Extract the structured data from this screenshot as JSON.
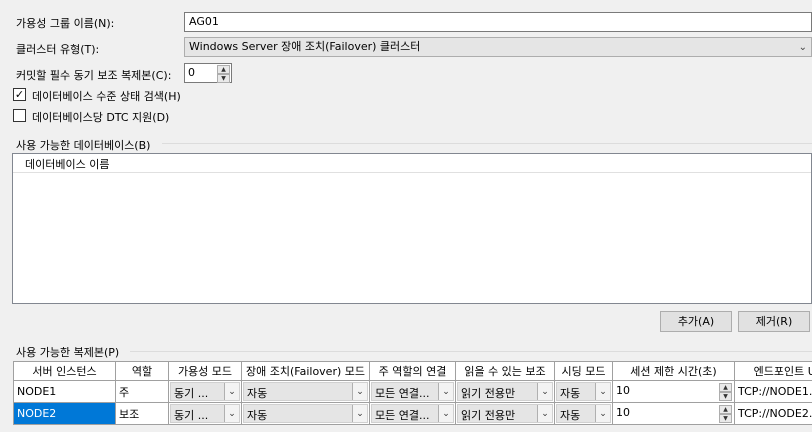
{
  "form": {
    "ag_name_label": "가용성 그룹 이름(N):",
    "ag_name_value": "AG01",
    "cluster_type_label": "클러스터 유형(T):",
    "cluster_type_value": "Windows Server 장애 조치(Failover) 클러스터",
    "required_sync_label": "커밋할 필수 동기 보조 복제본(C):",
    "required_sync_value": "0",
    "db_health_label": "데이터베이스 수준 상태 검색(H)",
    "db_health_checked": true,
    "dtc_label": "데이터베이스당 DTC 지원(D)",
    "dtc_checked": false
  },
  "databases": {
    "group_label": "사용 가능한 데이터베이스(B)",
    "column_header": "데이터베이스 이름",
    "add_label": "추가(A)",
    "remove_label": "제거(R)"
  },
  "replicas": {
    "group_label": "사용 가능한 복제본(P)",
    "columns": [
      "서버 인스턴스",
      "역할",
      "가용성 모드",
      "장애 조치(Failover) 모드",
      "주 역할의 연결",
      "읽을 수 있는 보조",
      "시딩 모드",
      "세션 제한 시간(초)",
      "엔드포인트 UR"
    ],
    "rows": [
      {
        "server": "NODE1",
        "role": "주",
        "availability": "동기 ...",
        "failover": "자동",
        "primary_conn": "모든 연결...",
        "readable": "읽기 전용만",
        "seeding": "자동",
        "timeout": "10",
        "endpoint": "TCP://NODE1.",
        "selected": false
      },
      {
        "server": "NODE2",
        "role": "보조",
        "availability": "동기 ...",
        "failover": "자동",
        "primary_conn": "모든 연결...",
        "readable": "읽기 전용만",
        "seeding": "자동",
        "timeout": "10",
        "endpoint": "TCP://NODE2.",
        "selected": true
      }
    ]
  },
  "icons": {
    "dropdown": "chevron-down-icon",
    "spin_up": "spin-up-icon",
    "spin_down": "spin-down-icon",
    "check": "check-icon"
  },
  "colors": {
    "selection": "#0078d7",
    "window_bg": "#f0f0f0"
  }
}
